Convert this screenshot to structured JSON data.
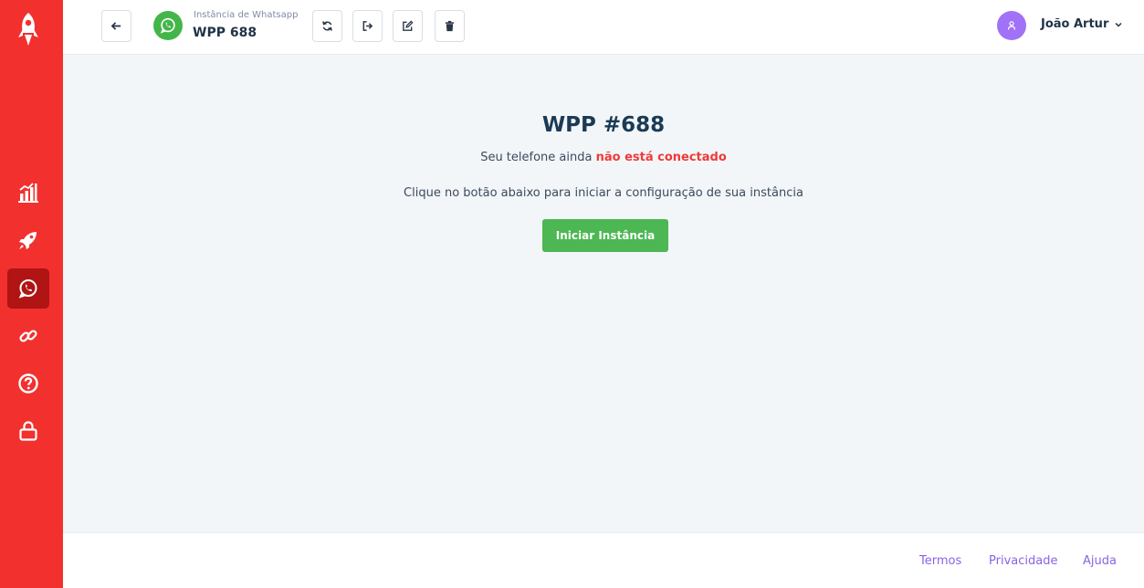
{
  "colors": {
    "sidebar": "#f2302e",
    "sidebar_active": "#b01413",
    "whatsapp_green": "#43b649",
    "start_button": "#4cb753",
    "disconnected_text": "#ef3a38",
    "avatar": "#a171f7",
    "footer_links": "#8a63e6"
  },
  "sidebar": {
    "items": [
      {
        "icon": "chart-icon"
      },
      {
        "icon": "rocket-icon"
      },
      {
        "icon": "whatsapp-icon",
        "active": true
      },
      {
        "icon": "link-icon"
      },
      {
        "icon": "help-icon"
      },
      {
        "icon": "lock-icon"
      }
    ]
  },
  "header": {
    "instance_label": "Instância de Whatsapp",
    "instance_name": "WPP 688",
    "buttons": [
      "back-arrow-icon",
      "refresh-icon",
      "logout-icon",
      "edit-icon",
      "trash-icon"
    ],
    "user_name": "João Artur"
  },
  "main": {
    "title": "WPP #688",
    "status_prefix": "Seu telefone ainda ",
    "status_highlight": "não está conectado",
    "hint": "Clique no botão abaixo para iniciar a configuração de sua instância",
    "start_button": "Iniciar Instância"
  },
  "footer": {
    "links": [
      "Termos",
      "Privacidade",
      "Ajuda"
    ]
  }
}
